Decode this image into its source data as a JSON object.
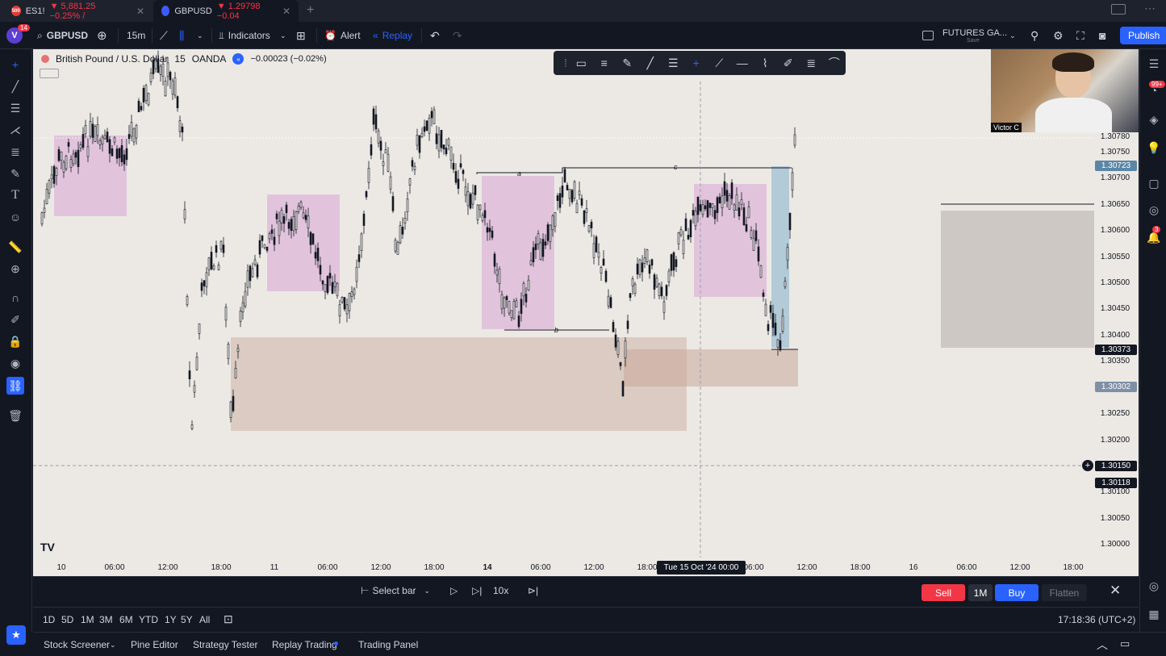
{
  "browser_tabs": [
    {
      "symbol": "ES1!",
      "change": "▼ 5,881.25 −0.25% /",
      "favicon": "500"
    },
    {
      "symbol": "GBPUSD",
      "change": "▼ 1.29798 −0.04"
    }
  ],
  "toolbar": {
    "profile_badge": "14",
    "symbol": "GBPUSD",
    "interval": "15m",
    "indicators": "Indicators",
    "alert": "Alert",
    "replay": "Replay",
    "layout_name": "FUTURES GA...",
    "layout_sub": "Save",
    "publish": "Publish"
  },
  "chart": {
    "symbol_name": "British Pound / U.S. Dollar",
    "interval": "15",
    "broker": "OANDA",
    "change": "−0.00023 (−0.02%)",
    "webcam_name": "Victor C",
    "zone_labels": {
      "a": "a",
      "b": "b",
      "c": "c"
    },
    "price_labels": [
      "1.30780",
      "1.30750",
      "1.30700",
      "1.30650",
      "1.30600",
      "1.30550",
      "1.30500",
      "1.30450",
      "1.30400",
      "1.30350",
      "1.30250",
      "1.30200",
      "1.30100",
      "1.30050",
      "1.30000"
    ],
    "price_tags": {
      "upper": "1.30723",
      "current": "1.30373",
      "lower": "1.30302",
      "crosshair": "1.30150",
      "bottom": "1.30118"
    },
    "time_labels": [
      "10",
      "06:00",
      "12:00",
      "18:00",
      "11",
      "06:00",
      "12:00",
      "18:00",
      "14",
      "06:00",
      "12:00",
      "18:00",
      "06:00",
      "12:00",
      "18:00",
      "16",
      "06:00",
      "12:00",
      "18:00"
    ],
    "crosshair_time": "Tue 15 Oct '24   00:00",
    "colors": {
      "up": "#131722",
      "zone_pink": "#d9a6d6",
      "zone_brown": "#c8a79a",
      "zone_blue": "#6fa3c7",
      "zone_gray": "#b9b3ad",
      "bg": "#ece9e4"
    }
  },
  "replay_bar": {
    "select_bar": "Select bar",
    "speed": "10x",
    "sell": "Sell",
    "quantity": "1M",
    "buy": "Buy",
    "flatten": "Flatten"
  },
  "range_bar": {
    "ranges": [
      "1D",
      "5D",
      "1M",
      "3M",
      "6M",
      "YTD",
      "1Y",
      "5Y",
      "All"
    ],
    "clock": "17:18:36 (UTC+2)"
  },
  "bottom_panel": {
    "tabs": [
      "Stock Screener",
      "Pine Editor",
      "Strategy Tester",
      "Replay Trading",
      "Trading Panel"
    ]
  },
  "right_badges": {
    "notifications": "99+",
    "alerts": "3"
  }
}
